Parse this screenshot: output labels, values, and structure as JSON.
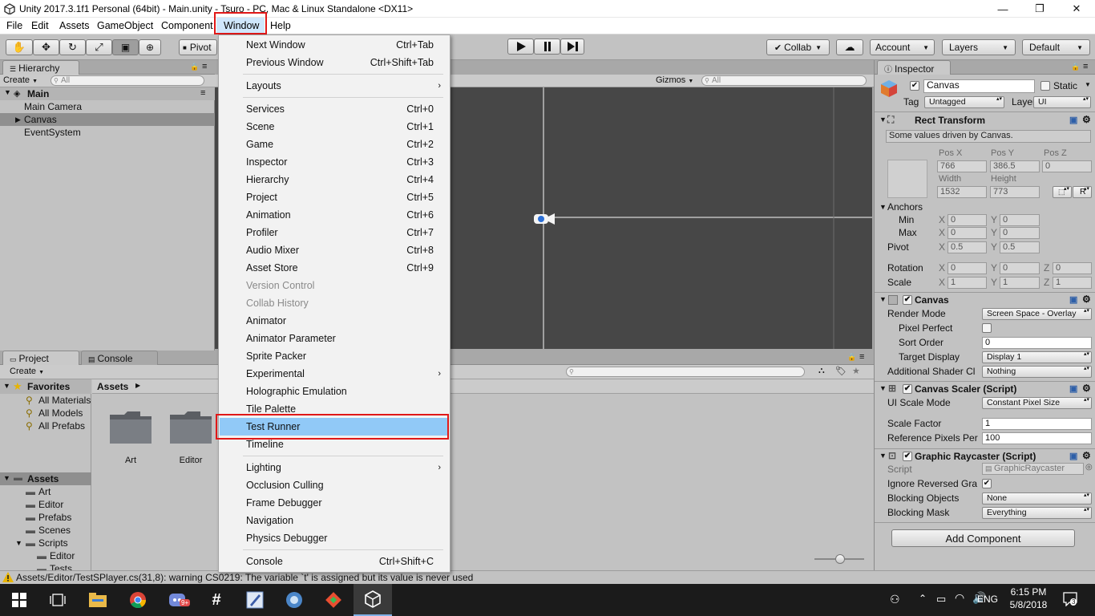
{
  "window": {
    "title": "Unity 2017.3.1f1 Personal (64bit) - Main.unity - Tsuro - PC, Mac & Linux Standalone <DX11>",
    "minimize": "—",
    "maximize": "❐",
    "close": "✕"
  },
  "menubar": {
    "items": [
      "File",
      "Edit",
      "Assets",
      "GameObject",
      "Component",
      "Window",
      "Help"
    ],
    "active": "Window"
  },
  "toolbar": {
    "pivot_label": "Pivot",
    "collab_label": "Collab",
    "account_label": "Account",
    "layers_label": "Layers",
    "layout_label": "Default"
  },
  "hierarchy": {
    "tab_label": "Hierarchy",
    "create_label": "Create",
    "search_placeholder": "All",
    "scene_name": "Main",
    "items": [
      "Main Camera",
      "Canvas",
      "EventSystem"
    ],
    "selected": "Canvas"
  },
  "scene_view": {
    "gizmos_label": "Gizmos",
    "search_placeholder": "All"
  },
  "project": {
    "tab_label": "Project",
    "console_tab_label": "Console",
    "create_label": "Create",
    "favorites_label": "Favorites",
    "favorites": [
      "All Materials",
      "All Models",
      "All Prefabs"
    ],
    "assets_label": "Assets",
    "asset_folders": [
      "Art",
      "Editor",
      "Prefabs",
      "Scenes",
      "Scripts"
    ],
    "script_subfolders": [
      "Editor",
      "Tests"
    ],
    "breadcrumb": "Assets",
    "grid_items": [
      "Art",
      "Editor"
    ]
  },
  "inspector": {
    "tab_label": "Inspector",
    "object_name": "Canvas",
    "static_label": "Static",
    "tag_label": "Tag",
    "tag_value": "Untagged",
    "layer_label": "Layer",
    "layer_value": "UI",
    "rect_transform": {
      "title": "Rect Transform",
      "note": "Some values driven by Canvas.",
      "pos_x_label": "Pos X",
      "pos_x": "766",
      "pos_y_label": "Pos Y",
      "pos_y": "386.5",
      "pos_z_label": "Pos Z",
      "pos_z": "0",
      "width_label": "Width",
      "width": "1532",
      "height_label": "Height",
      "height": "773",
      "r_label": "R",
      "anchors_label": "Anchors",
      "min_label": "Min",
      "min_x": "0",
      "min_y": "0",
      "max_label": "Max",
      "max_x": "0",
      "max_y": "0",
      "pivot_label": "Pivot",
      "pivot_x": "0.5",
      "pivot_y": "0.5",
      "rotation_label": "Rotation",
      "rot_x": "0",
      "rot_y": "0",
      "rot_z": "0",
      "scale_label": "Scale",
      "scale_x": "1",
      "scale_y": "1",
      "scale_z": "1",
      "x": "X",
      "y": "Y",
      "z": "Z"
    },
    "canvas": {
      "title": "Canvas",
      "render_mode_label": "Render Mode",
      "render_mode": "Screen Space - Overlay",
      "pixel_perfect_label": "Pixel Perfect",
      "sort_order_label": "Sort Order",
      "sort_order": "0",
      "target_display_label": "Target Display",
      "target_display": "Display 1",
      "shader_label": "Additional Shader Cl",
      "shader_value": "Nothing"
    },
    "canvas_scaler": {
      "title": "Canvas Scaler (Script)",
      "scale_mode_label": "UI Scale Mode",
      "scale_mode": "Constant Pixel Size",
      "scale_factor_label": "Scale Factor",
      "scale_factor": "1",
      "ref_pixels_label": "Reference Pixels Per",
      "ref_pixels": "100"
    },
    "raycaster": {
      "title": "Graphic Raycaster (Script)",
      "script_label": "Script",
      "script_value": "GraphicRaycaster",
      "ignore_label": "Ignore Reversed Gra",
      "blocking_objects_label": "Blocking Objects",
      "blocking_objects": "None",
      "blocking_mask_label": "Blocking Mask",
      "blocking_mask": "Everything"
    },
    "add_component": "Add Component"
  },
  "window_menu": {
    "items": [
      {
        "label": "Next Window",
        "shortcut": "Ctrl+Tab"
      },
      {
        "label": "Previous Window",
        "shortcut": "Ctrl+Shift+Tab"
      },
      {
        "label": "Layouts",
        "submenu": true
      },
      {
        "label": "Services",
        "shortcut": "Ctrl+0"
      },
      {
        "label": "Scene",
        "shortcut": "Ctrl+1"
      },
      {
        "label": "Game",
        "shortcut": "Ctrl+2"
      },
      {
        "label": "Inspector",
        "shortcut": "Ctrl+3"
      },
      {
        "label": "Hierarchy",
        "shortcut": "Ctrl+4"
      },
      {
        "label": "Project",
        "shortcut": "Ctrl+5"
      },
      {
        "label": "Animation",
        "shortcut": "Ctrl+6"
      },
      {
        "label": "Profiler",
        "shortcut": "Ctrl+7"
      },
      {
        "label": "Audio Mixer",
        "shortcut": "Ctrl+8"
      },
      {
        "label": "Asset Store",
        "shortcut": "Ctrl+9"
      },
      {
        "label": "Version Control",
        "disabled": true
      },
      {
        "label": "Collab History",
        "disabled": true
      },
      {
        "label": "Animator"
      },
      {
        "label": "Animator Parameter"
      },
      {
        "label": "Sprite Packer"
      },
      {
        "label": "Experimental",
        "submenu": true
      },
      {
        "label": "Holographic Emulation"
      },
      {
        "label": "Tile Palette"
      },
      {
        "label": "Test Runner",
        "highlighted": true
      },
      {
        "label": "Timeline"
      },
      {
        "label": "Lighting",
        "submenu": true
      },
      {
        "label": "Occlusion Culling"
      },
      {
        "label": "Frame Debugger"
      },
      {
        "label": "Navigation"
      },
      {
        "label": "Physics Debugger"
      },
      {
        "label": "Console",
        "shortcut": "Ctrl+Shift+C"
      }
    ]
  },
  "status": {
    "message": "Assets/Editor/TestSPlayer.cs(31,8): warning CS0219: The variable `t' is assigned but its value is never used"
  },
  "taskbar": {
    "language": "ENG",
    "time": "6:15 PM",
    "date": "5/8/2018",
    "notifications": "3",
    "badge": "9+"
  },
  "colors": {
    "highlight": "#91c9f7",
    "annotation_red": "#e01818",
    "scene_bg": "#474747",
    "taskbar_bg": "#1b1b1b"
  }
}
